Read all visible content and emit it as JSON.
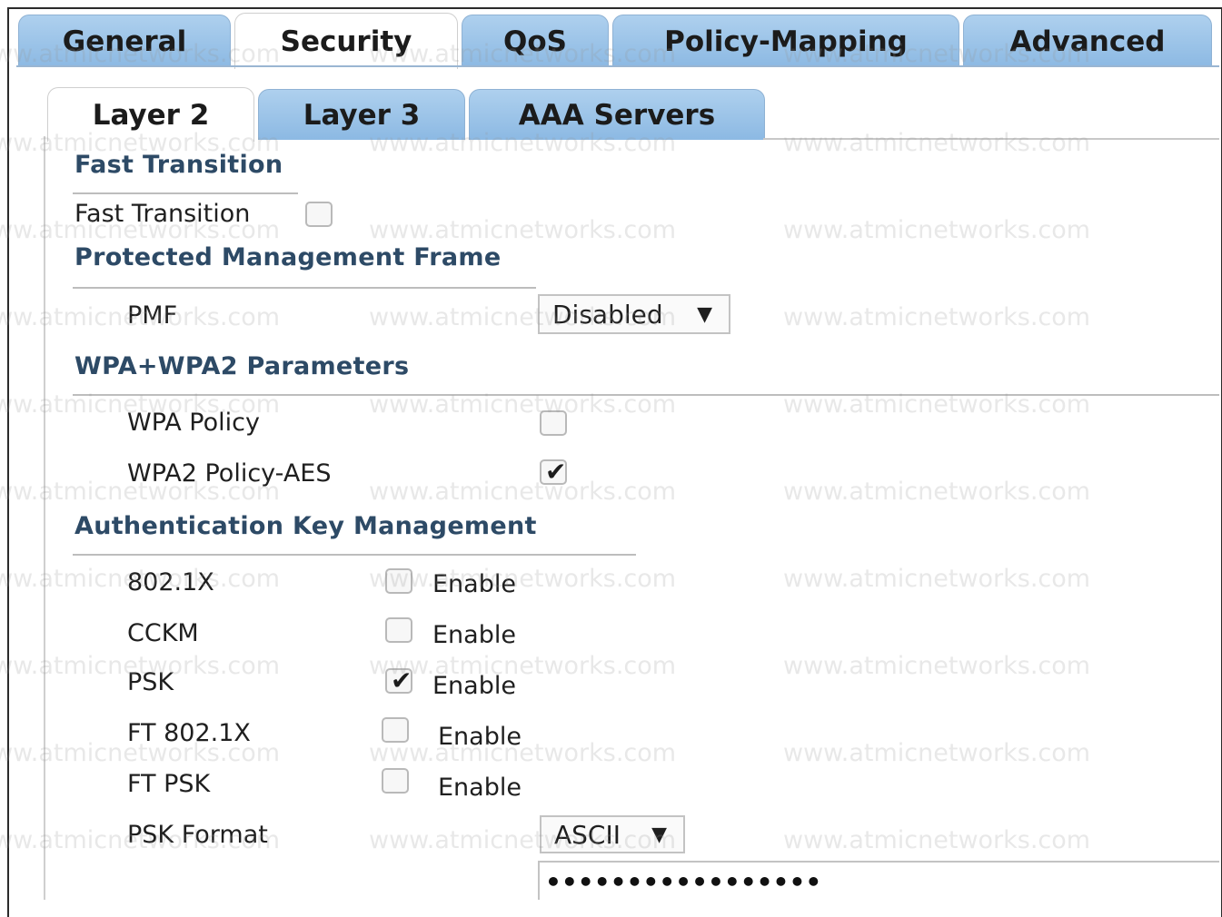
{
  "top_tabs": {
    "general": "General",
    "security": "Security",
    "qos": "QoS",
    "policy_mapping": "Policy-Mapping",
    "advanced": "Advanced",
    "active": "Security"
  },
  "sub_tabs": {
    "layer2": "Layer 2",
    "layer3": "Layer 3",
    "aaa": "AAA Servers",
    "active": "Layer 2"
  },
  "fast_transition": {
    "heading": "Fast Transition",
    "label": "Fast Transition",
    "checked": false
  },
  "pmf": {
    "heading": "Protected Management Frame",
    "label": "PMF",
    "value": "Disabled"
  },
  "wpa": {
    "heading": "WPA+WPA2 Parameters",
    "wpa_policy_label": "WPA Policy",
    "wpa_policy_checked": false,
    "wpa2_label": "WPA2 Policy-AES",
    "wpa2_checked": true
  },
  "akm": {
    "heading": "Authentication Key Management",
    "enable_text": "Enable",
    "items": [
      {
        "label": "802.1X",
        "checked": false
      },
      {
        "label": "CCKM",
        "checked": false
      },
      {
        "label": "PSK",
        "checked": true
      },
      {
        "label": "FT 802.1X",
        "checked": false
      },
      {
        "label": "FT PSK",
        "checked": false
      }
    ],
    "psk_format_label": "PSK Format",
    "psk_format_value": "ASCII",
    "psk_value": "•••••••••••••••••"
  },
  "watermark": "www.atmicnetworks.com",
  "icons": {
    "dropdown": "dropdown-arrow-icon",
    "check": "checkmark-icon"
  },
  "colors": {
    "tab_blue": "#9cc4e8",
    "heading": "#2d4a66"
  }
}
